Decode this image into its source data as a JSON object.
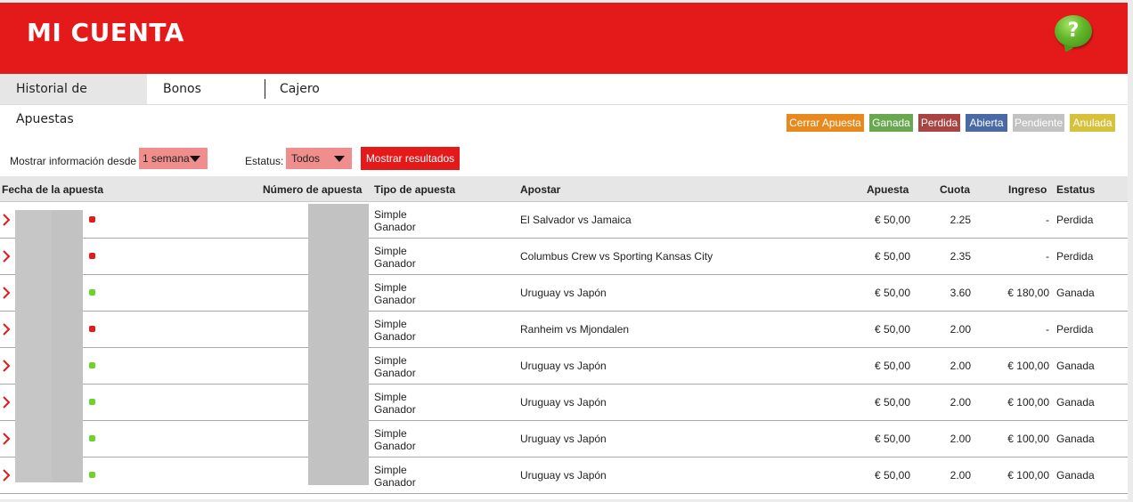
{
  "header": {
    "title": "MI CUENTA",
    "help_symbol": "?"
  },
  "tabs": [
    {
      "label": "Historial de Apuestas",
      "active": true
    },
    {
      "label": "Bonos",
      "active": false
    },
    {
      "label": "Cajero",
      "active": false
    }
  ],
  "legend": [
    {
      "label": "Cerrar Apuesta",
      "color": "#e8891e"
    },
    {
      "label": "Ganada",
      "color": "#6aa84f"
    },
    {
      "label": "Perdida",
      "color": "#a94442"
    },
    {
      "label": "Abierta",
      "color": "#4a6aa5"
    },
    {
      "label": "Pendiente",
      "color": "#c2c2c2"
    },
    {
      "label": "Anulada",
      "color": "#d8c13a"
    }
  ],
  "filters": {
    "from_label": "Mostrar información desde",
    "from_value": "1 semana",
    "status_label": "Estatus:",
    "status_value": "Todos",
    "show_button": "Mostrar resultados"
  },
  "table": {
    "headers": {
      "date": "Fecha de la apuesta",
      "number": "Número de apuesta",
      "type": "Tipo de apuesta",
      "bet": "Apostar",
      "stake": "Apuesta",
      "odds": "Cuota",
      "income": "Ingreso",
      "status": "Estatus"
    },
    "rows": [
      {
        "type1": "Simple",
        "type2": "Ganador",
        "bet": "El Salvador vs Jamaica",
        "stake": "€ 50,00",
        "odds": "2.25",
        "income": "-",
        "status": "Perdida",
        "dot": "#e3191a"
      },
      {
        "type1": "Simple",
        "type2": "Ganador",
        "bet": "Columbus Crew vs Sporting Kansas City",
        "stake": "€ 50,00",
        "odds": "2.35",
        "income": "-",
        "status": "Perdida",
        "dot": "#e3191a"
      },
      {
        "type1": "Simple",
        "type2": "Ganador",
        "bet": "Uruguay vs Japón",
        "stake": "€ 50,00",
        "odds": "3.60",
        "income": "€ 180,00",
        "status": "Ganada",
        "dot": "#6fd22c"
      },
      {
        "type1": "Simple",
        "type2": "Ganador",
        "bet": "Ranheim vs Mjondalen",
        "stake": "€ 50,00",
        "odds": "2.00",
        "income": "-",
        "status": "Perdida",
        "dot": "#e3191a"
      },
      {
        "type1": "Simple",
        "type2": "Ganador",
        "bet": "Uruguay vs Japón",
        "stake": "€ 50,00",
        "odds": "2.00",
        "income": "€ 100,00",
        "status": "Ganada",
        "dot": "#6fd22c"
      },
      {
        "type1": "Simple",
        "type2": "Ganador",
        "bet": "Uruguay vs Japón",
        "stake": "€ 50,00",
        "odds": "2.00",
        "income": "€ 100,00",
        "status": "Ganada",
        "dot": "#6fd22c"
      },
      {
        "type1": "Simple",
        "type2": "Ganador",
        "bet": "Uruguay vs Japón",
        "stake": "€ 50,00",
        "odds": "2.00",
        "income": "€ 100,00",
        "status": "Ganada",
        "dot": "#6fd22c"
      },
      {
        "type1": "Simple",
        "type2": "Ganador",
        "bet": "Uruguay vs Japón",
        "stake": "€ 50,00",
        "odds": "2.00",
        "income": "€ 100,00",
        "status": "Ganada",
        "dot": "#6fd22c"
      }
    ]
  }
}
